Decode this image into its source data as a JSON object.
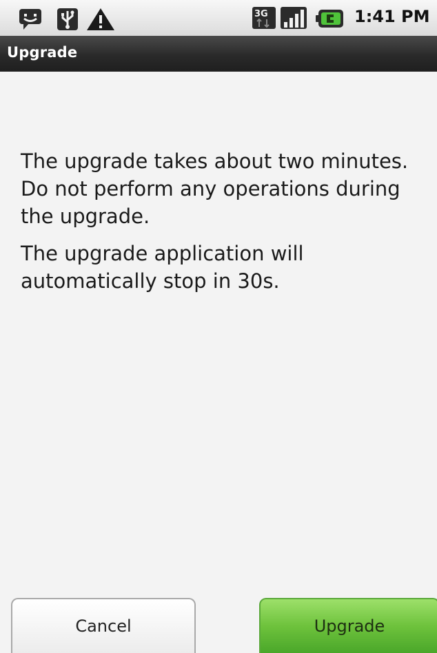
{
  "status_bar": {
    "icons": [
      "chat-notification-icon",
      "usb-icon",
      "warning-icon",
      "3g-icon",
      "signal-icon",
      "battery-charging-icon"
    ],
    "time": "1:41 PM"
  },
  "title_bar": {
    "title": "Upgrade"
  },
  "message": {
    "paragraph1": "The upgrade takes about two minutes. Do not perform any operations during the upgrade.",
    "paragraph2": "The upgrade application will automatically stop in 30s."
  },
  "buttons": {
    "cancel_label": "Cancel",
    "upgrade_label": "Upgrade"
  },
  "colors": {
    "title_bar_bg": "#2a2a2a",
    "primary_button": "#6ec23c",
    "page_bg": "#f3f3f3"
  }
}
